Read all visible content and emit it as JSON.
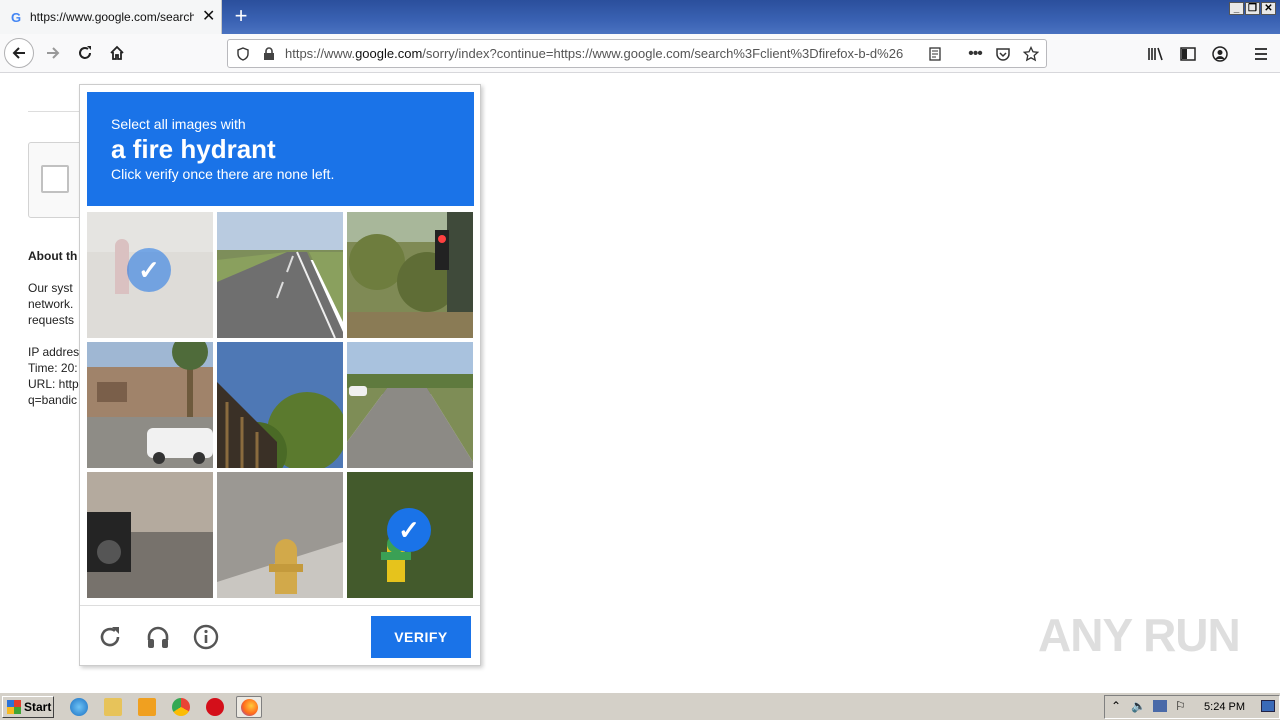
{
  "browser": {
    "tab_title": "https://www.google.com/search?c",
    "tab_favicon": "G",
    "url_prefix": "https://www.",
    "url_domain": "google.com",
    "url_rest": "/sorry/index?continue=https://www.google.com/search%3Fclient%3Dfirefox-b-d%26"
  },
  "page": {
    "about_heading": "About th",
    "para1": "Our syst\nnetwork.\nrequests",
    "para2": "IP addres\nTime: 20:\nURL: http\nq=bandic"
  },
  "captcha": {
    "instruction_line1": "Select all images with",
    "target_object": "a fire hydrant",
    "instruction_line3": "Click verify once there are none left.",
    "verify_label": "VERIFY",
    "selected_tiles": [
      0,
      8
    ],
    "footer_icons": [
      "reload-icon",
      "audio-headphones-icon",
      "info-icon"
    ],
    "accent_color": "#1a73e8"
  },
  "watermark": "ANY RUN",
  "taskbar": {
    "start_label": "Start",
    "clock": "5:24 PM"
  }
}
